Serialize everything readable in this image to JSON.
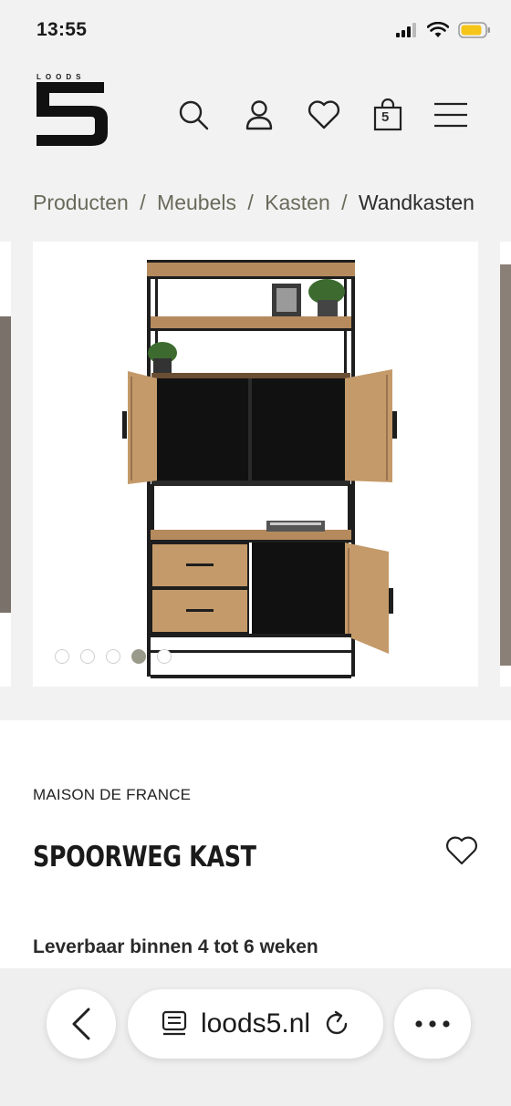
{
  "status_bar": {
    "time": "13:55"
  },
  "logo": {
    "small_text": "LOODS",
    "numeral": "5"
  },
  "header": {
    "icons": [
      "search-icon",
      "account-icon",
      "heart-icon",
      "shopping-bag-icon",
      "menu-icon"
    ],
    "cart_count": "5"
  },
  "breadcrumb": {
    "items": [
      "Producten",
      "Meubels",
      "Kasten"
    ],
    "current": "Wandkasten",
    "separator": "/"
  },
  "gallery": {
    "slide_count": 5,
    "active_index": 3
  },
  "product": {
    "brand": "MAISON DE FRANCE",
    "title": "SPOORWEG KAST",
    "delivery": "Leverbaar binnen 4 tot 6 weken"
  },
  "browser": {
    "url": "loods5.nl"
  },
  "colors": {
    "wood": "#b58b5e",
    "frame": "#1e1e1e",
    "accent_gray": "#9a9a8a"
  }
}
